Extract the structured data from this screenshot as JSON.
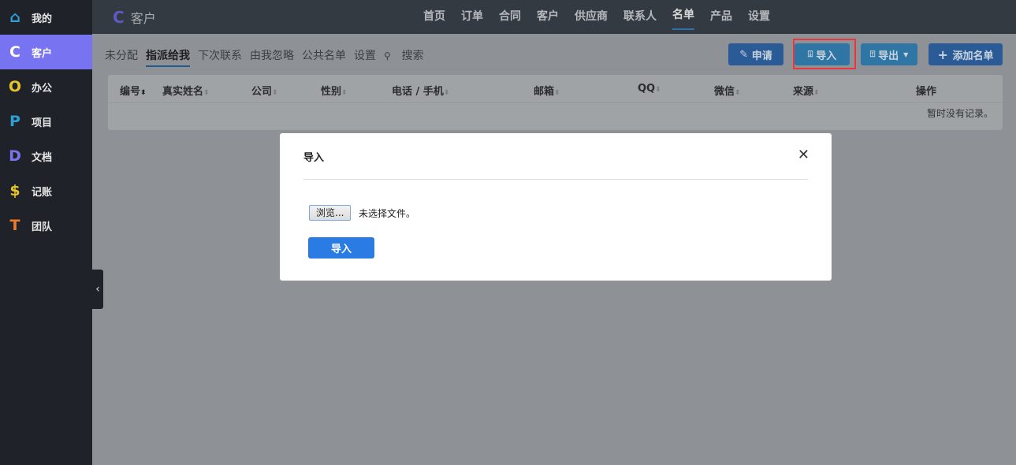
{
  "sidebar": {
    "items": [
      {
        "label": "我的",
        "icon": "⌂",
        "color": "#2f9fd8"
      },
      {
        "label": "客户",
        "icon": "C",
        "color": "#ffffff"
      },
      {
        "label": "办公",
        "icon": "O",
        "color": "#e8c42b"
      },
      {
        "label": "项目",
        "icon": "P",
        "color": "#2f9fd8"
      },
      {
        "label": "文档",
        "icon": "D",
        "color": "#7b74ee"
      },
      {
        "label": "记账",
        "icon": "$",
        "color": "#e8c42b"
      },
      {
        "label": "团队",
        "icon": "T",
        "color": "#f07c2a"
      }
    ]
  },
  "header": {
    "logo": "C",
    "title": "客户",
    "nav": [
      "首页",
      "订单",
      "合同",
      "客户",
      "供应商",
      "联系人",
      "名单",
      "产品",
      "设置"
    ]
  },
  "subnav": [
    "未分配",
    "指派给我",
    "下次联系",
    "由我忽略",
    "公共名单",
    "设置"
  ],
  "search_label": "搜索",
  "toolbar": {
    "apply": "申请",
    "import": "导入",
    "export": "导出",
    "add": "添加名单"
  },
  "table": {
    "headers": [
      "编号",
      "真实姓名",
      "公司",
      "性别",
      "电话 / 手机",
      "邮箱",
      "QQ",
      "微信",
      "来源",
      "操作"
    ],
    "empty": "暂时没有记录。"
  },
  "modal": {
    "title": "导入",
    "browse": "浏览...",
    "no_file": "未选择文件。",
    "submit": "导入"
  }
}
